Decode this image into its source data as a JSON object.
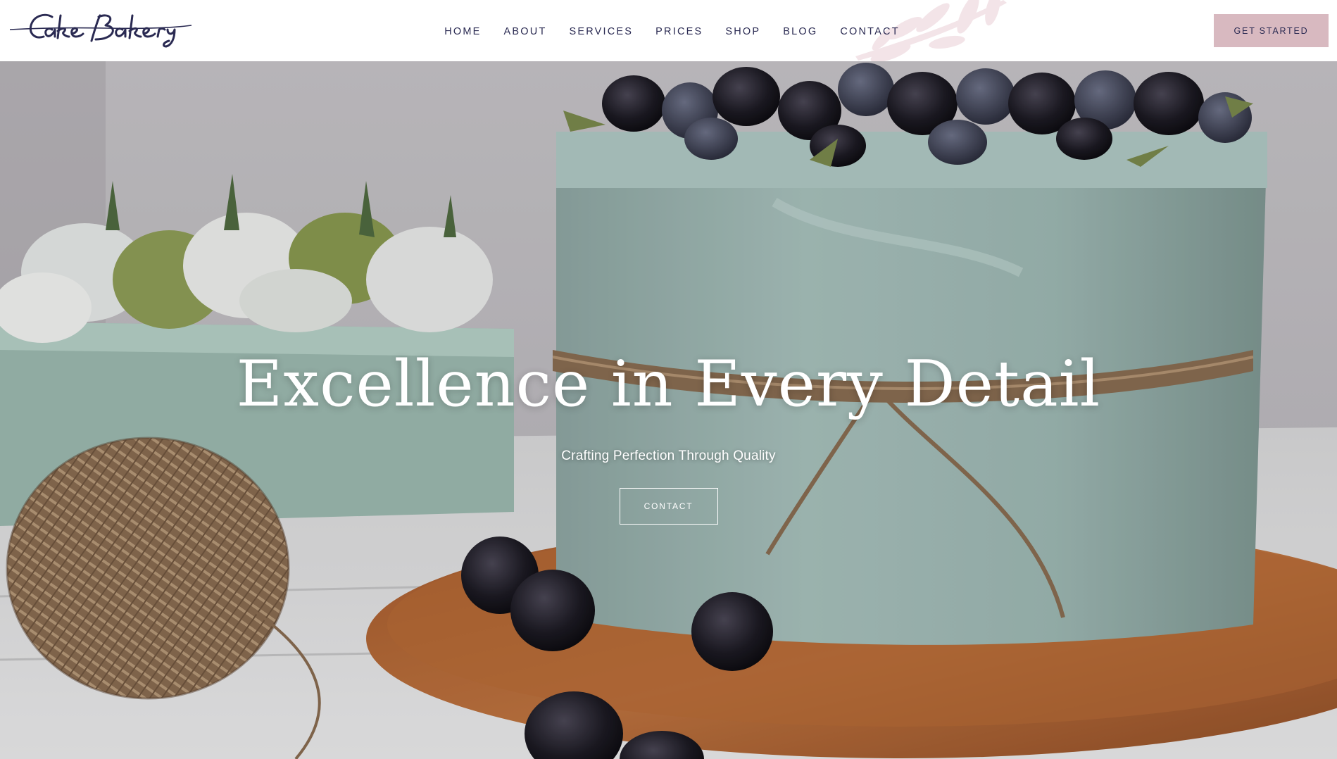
{
  "brand": {
    "logo_text": "Cake Bakery"
  },
  "nav": {
    "items": [
      {
        "label": "HOME"
      },
      {
        "label": "ABOUT"
      },
      {
        "label": "SERVICES"
      },
      {
        "label": "PRICES"
      },
      {
        "label": "SHOP"
      },
      {
        "label": "BLOG"
      },
      {
        "label": "CONTACT"
      }
    ]
  },
  "header": {
    "cta_label": "GET STARTED"
  },
  "hero": {
    "title": "Excellence in Every Detail",
    "subtitle": "Crafting Perfection Through Quality",
    "button_label": "CONTACT"
  },
  "colors": {
    "navy_text": "#2a2a52",
    "pink_button": "#d8b9c0",
    "hero_text": "#ffffff"
  },
  "icons": {
    "decoration": "leaf-branch-icon"
  }
}
